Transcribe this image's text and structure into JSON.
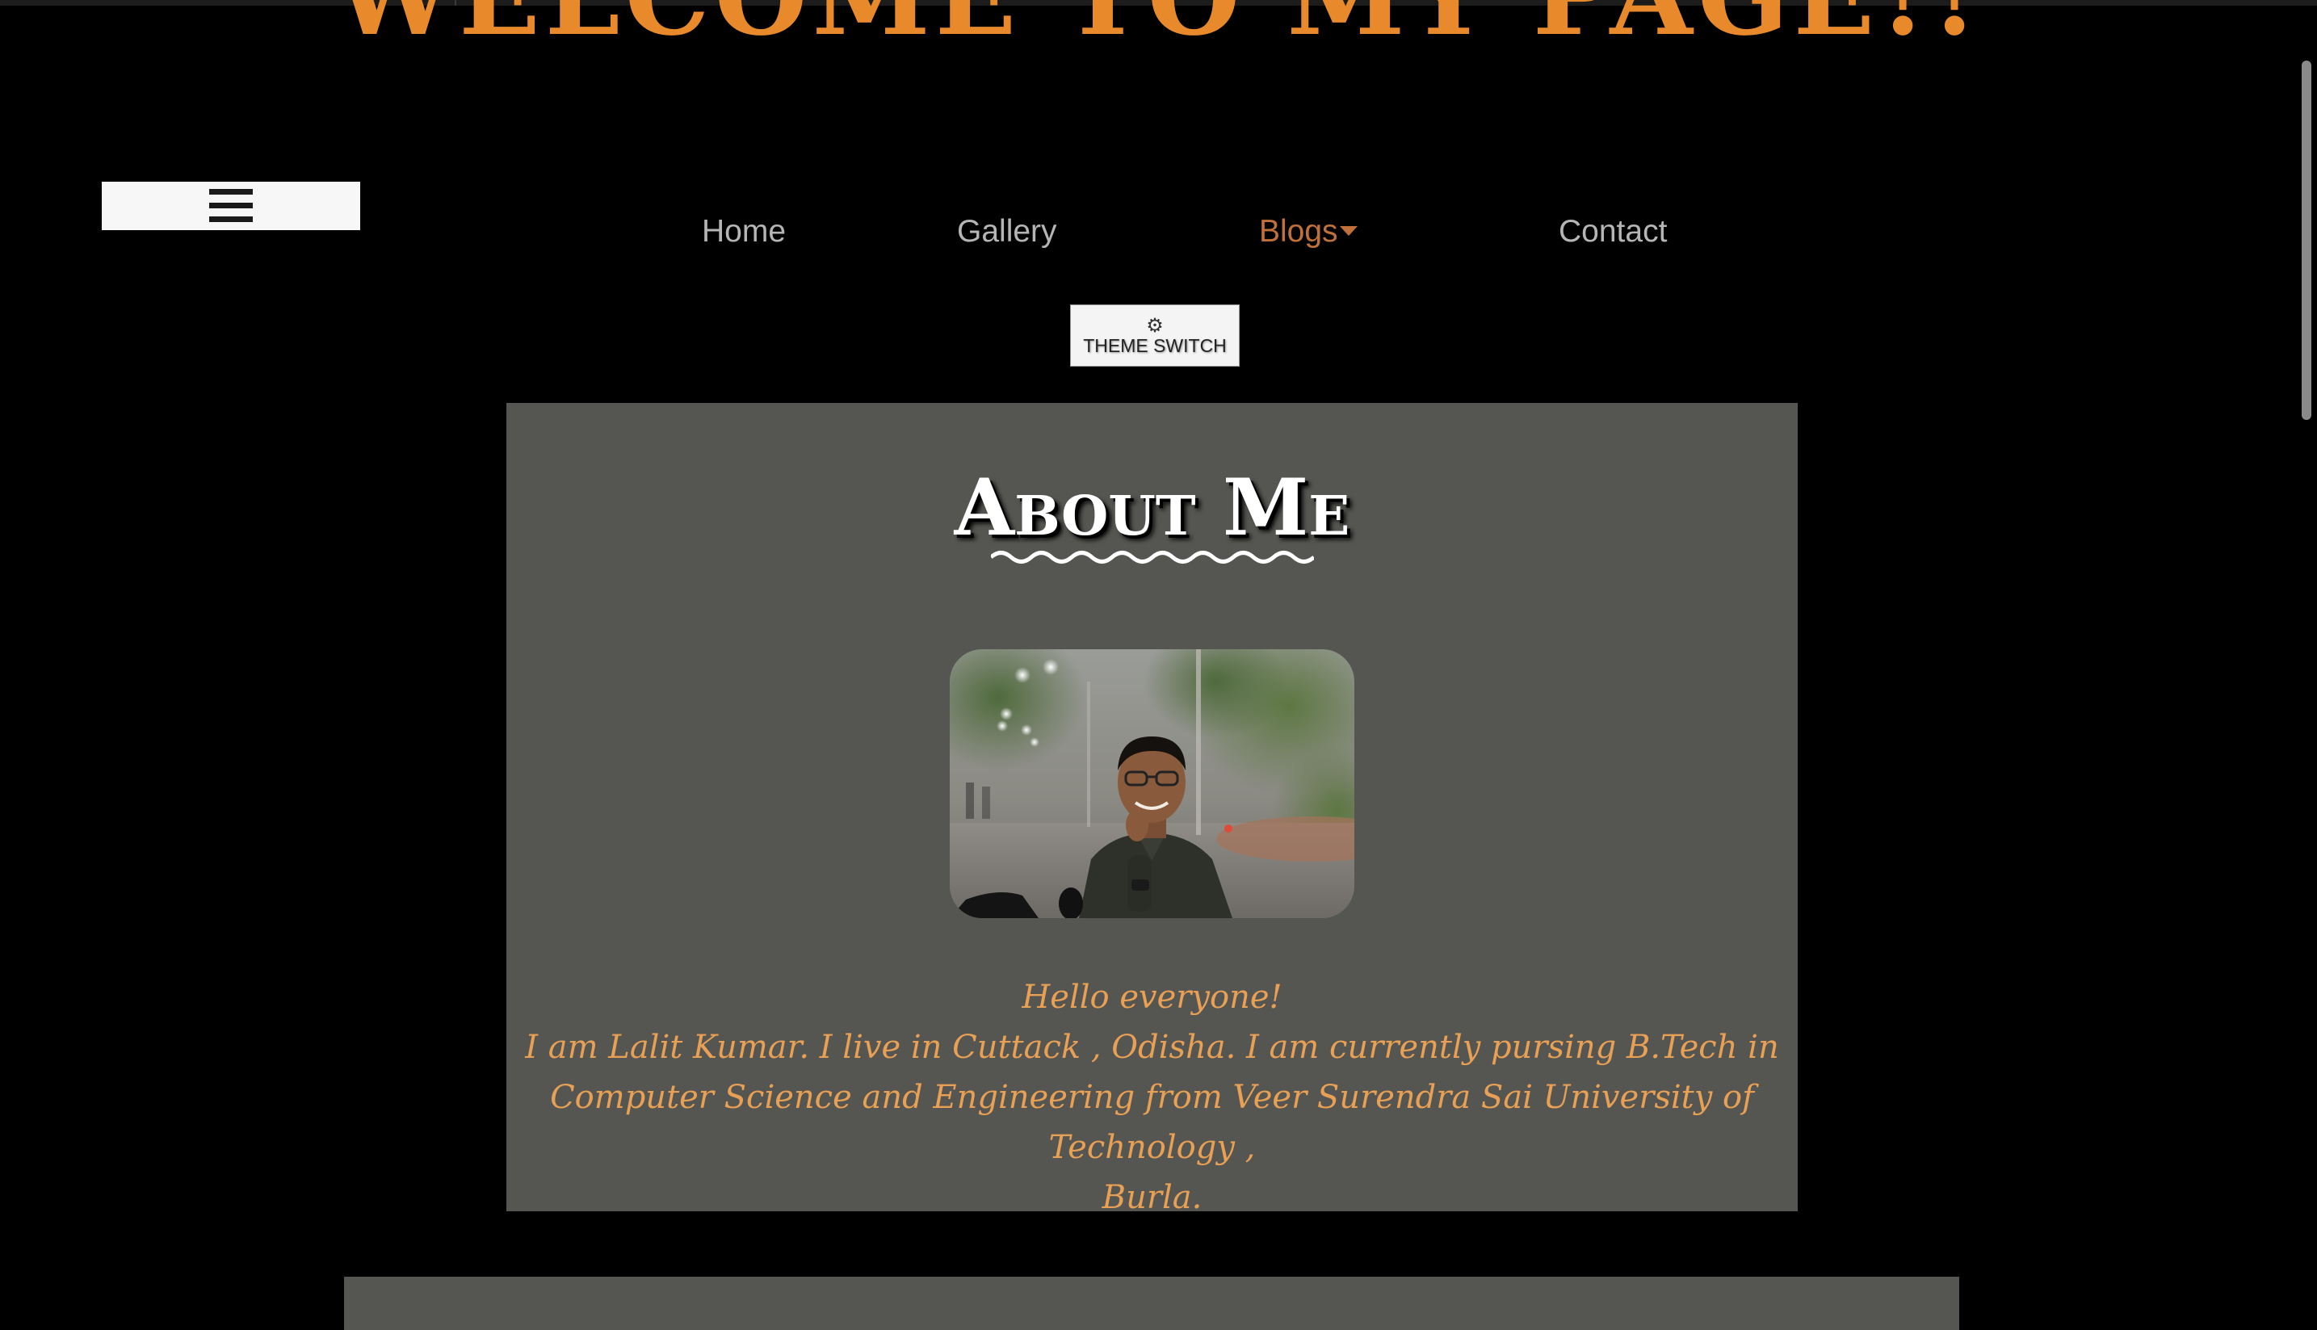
{
  "header": {
    "welcome_title": "WELCOME TO MY PAGE!!"
  },
  "menu_button": {
    "icon": "hamburger-menu-icon"
  },
  "nav": {
    "items": [
      {
        "label": "Home"
      },
      {
        "label": "Gallery"
      },
      {
        "label": "Blogs",
        "has_dropdown": true,
        "active": true
      },
      {
        "label": "Contact"
      }
    ]
  },
  "theme_switch": {
    "icon": "gear-icon",
    "label": "THEME SWITCH"
  },
  "about": {
    "title": "About Me",
    "photo_alt": "profile-photo",
    "greeting": "Hello everyone!",
    "bio_line1": "I am Lalit Kumar. I live in Cuttack , Odisha. I am currently pursing B.Tech in",
    "bio_line2": "Computer Science and Engineering from Veer Surendra Sai University of Technology ,",
    "bio_line3": "Burla."
  },
  "colors": {
    "background": "#000000",
    "accent_orange": "#e88a2c",
    "nav_text": "#b5b5b5",
    "nav_active": "#c0713a",
    "card_bg": "#555551",
    "bio_text": "#e8a055"
  }
}
